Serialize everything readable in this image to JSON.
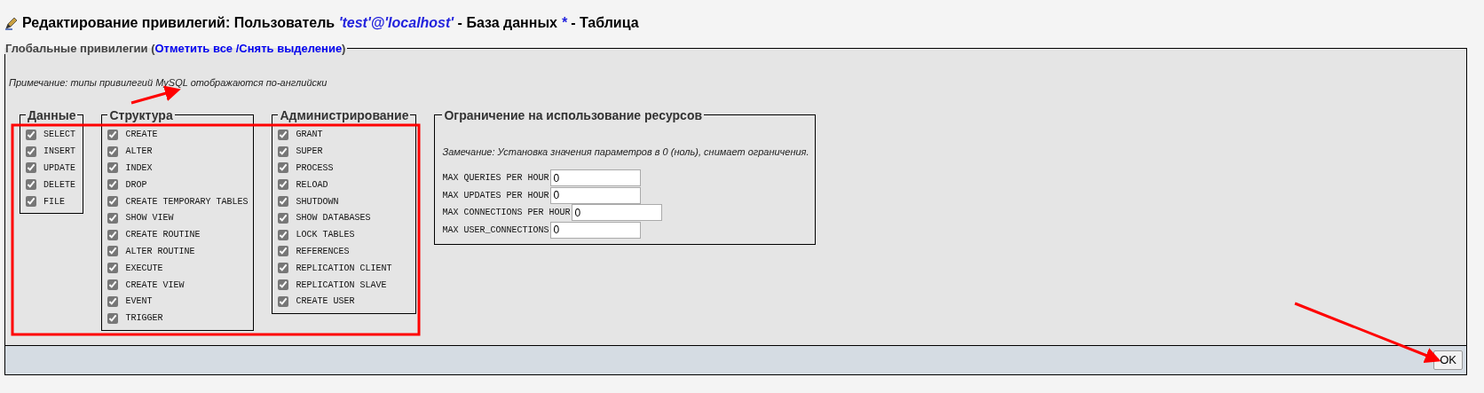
{
  "title": {
    "segments": [
      {
        "text": "Редактирование привилегий: Пользователь ",
        "kind": "plain"
      },
      {
        "text": "'test'@'localhost'",
        "kind": "value"
      },
      {
        "text": " - База данных ",
        "kind": "plain"
      },
      {
        "text": "*",
        "kind": "value"
      },
      {
        "text": " - Таблица",
        "kind": "plain"
      }
    ]
  },
  "global": {
    "legend": "Глобальные привилегии (",
    "check_all": "Отметить все",
    "separator": " /",
    "uncheck_all": "Снять выделение",
    "legend_close": ")",
    "note": "Примечание: типы привилегий MySQL отображаются по-английски",
    "groups": [
      {
        "title": "Данные",
        "items": [
          {
            "label": "SELECT",
            "checked": true
          },
          {
            "label": "INSERT",
            "checked": true
          },
          {
            "label": "UPDATE",
            "checked": true
          },
          {
            "label": "DELETE",
            "checked": true
          },
          {
            "label": "FILE",
            "checked": true
          }
        ]
      },
      {
        "title": "Структура",
        "items": [
          {
            "label": "CREATE",
            "checked": true
          },
          {
            "label": "ALTER",
            "checked": true
          },
          {
            "label": "INDEX",
            "checked": true
          },
          {
            "label": "DROP",
            "checked": true
          },
          {
            "label": "CREATE TEMPORARY TABLES",
            "checked": true
          },
          {
            "label": "SHOW VIEW",
            "checked": true
          },
          {
            "label": "CREATE ROUTINE",
            "checked": true
          },
          {
            "label": "ALTER ROUTINE",
            "checked": true
          },
          {
            "label": "EXECUTE",
            "checked": true
          },
          {
            "label": "CREATE VIEW",
            "checked": true
          },
          {
            "label": "EVENT",
            "checked": true
          },
          {
            "label": "TRIGGER",
            "checked": true
          }
        ]
      },
      {
        "title": "Администрирование",
        "items": [
          {
            "label": "GRANT",
            "checked": true
          },
          {
            "label": "SUPER",
            "checked": true
          },
          {
            "label": "PROCESS",
            "checked": true
          },
          {
            "label": "RELOAD",
            "checked": true
          },
          {
            "label": "SHUTDOWN",
            "checked": true
          },
          {
            "label": "SHOW DATABASES",
            "checked": true
          },
          {
            "label": "LOCK TABLES",
            "checked": true
          },
          {
            "label": "REFERENCES",
            "checked": true
          },
          {
            "label": "REPLICATION CLIENT",
            "checked": true
          },
          {
            "label": "REPLICATION SLAVE",
            "checked": true
          },
          {
            "label": "CREATE USER",
            "checked": true
          }
        ]
      }
    ],
    "resources": {
      "title": "Ограничение на использование ресурсов",
      "note": "Замечание: Установка значения параметров в 0 (ноль), снимает ограничения.",
      "limits": [
        {
          "label": "MAX QUERIES PER HOUR",
          "value": "0"
        },
        {
          "label": "MAX UPDATES PER HOUR",
          "value": "0"
        },
        {
          "label": "MAX CONNECTIONS PER HOUR",
          "value": "0"
        },
        {
          "label": "MAX USER_CONNECTIONS",
          "value": "0"
        }
      ]
    }
  },
  "submit": "OK"
}
